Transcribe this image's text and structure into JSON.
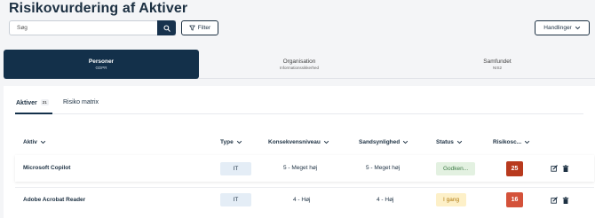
{
  "header": {
    "title": "Risikovurdering af Aktiver",
    "search_placeholder": "Søg",
    "filter_label": "Filter",
    "actions_label": "Handlinger"
  },
  "main_tabs": [
    {
      "label": "Personer",
      "sublabel": "GDPR",
      "active": true
    },
    {
      "label": "Organisation",
      "sublabel": "Informationssikkerhed",
      "active": false
    },
    {
      "label": "Samfundet",
      "sublabel": "NIS2",
      "active": false
    }
  ],
  "sub_tabs": [
    {
      "label": "Aktiver",
      "count": "21",
      "active": true
    },
    {
      "label": "Risiko matrix",
      "active": false
    }
  ],
  "table": {
    "columns": [
      "Aktiv",
      "Type",
      "Konsekvensniveau",
      "Sandsynlighed",
      "Status",
      "Risikosc..."
    ],
    "rows": [
      {
        "asset": "Microsoft Copilot",
        "type": "IT",
        "consequence": "5 - Meget høj",
        "probability": "5 - Meget høj",
        "status": "Godken...",
        "score": "25"
      },
      {
        "asset": "Adobe Acrobat Reader",
        "type": "IT",
        "consequence": "4 - Høj",
        "probability": "4 - Høj",
        "status": "I gang",
        "score": "16"
      }
    ]
  },
  "colors": {
    "primary_navy": "#13304a",
    "status_approved_bg": "#e3f1e1",
    "status_approved_text": "#3c7a45",
    "status_inprogress_bg": "#fdf0c8",
    "status_inprogress_text": "#b07a10",
    "score_high": "#b83a1e",
    "score_medium": "#d4523a"
  },
  "icons": {
    "search": "search-icon",
    "filter": "filter-icon",
    "chevron": "chevron-down-icon",
    "edit": "edit-icon",
    "delete": "trash-icon"
  }
}
